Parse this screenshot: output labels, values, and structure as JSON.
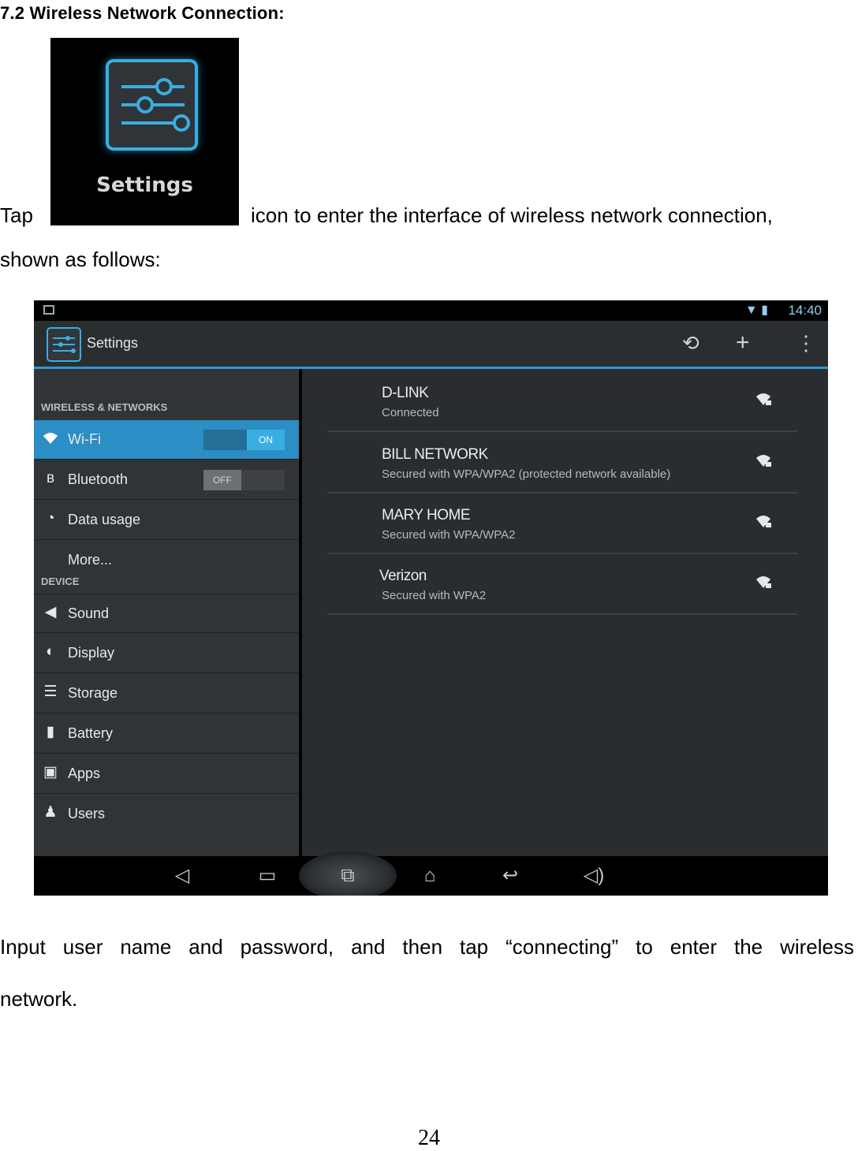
{
  "heading": "7.2 Wireless Network Connection:",
  "settings_badge_label": "Settings",
  "intro": {
    "before": "Tap",
    "after": "icon to enter the interface of wireless network connection,",
    "line2": "shown as follows:"
  },
  "screenshot": {
    "status_time": "14:40",
    "action_bar_title": "Settings",
    "sidebar": {
      "header_wireless": "WIRELESS & NETWORKS",
      "header_device": "DEVICE",
      "items": [
        {
          "label": "Wi-Fi",
          "icon": "wifi-icon",
          "toggle": "ON"
        },
        {
          "label": "Bluetooth",
          "icon": "bluetooth-icon",
          "toggle": "OFF"
        },
        {
          "label": "Data usage",
          "icon": "data-usage-icon"
        },
        {
          "label": "More..."
        },
        {
          "label": "Sound",
          "icon": "speaker-icon"
        },
        {
          "label": "Display",
          "icon": "display-icon"
        },
        {
          "label": "Storage",
          "icon": "storage-icon"
        },
        {
          "label": "Battery",
          "icon": "battery-icon"
        },
        {
          "label": "Apps",
          "icon": "apps-icon"
        },
        {
          "label": "Users",
          "icon": "users-icon"
        }
      ]
    },
    "networks": [
      {
        "name": "D-LINK",
        "status": "Connected"
      },
      {
        "name": "BILL NETWORK",
        "status": "Secured with WPA/WPA2 (protected network available)"
      },
      {
        "name": "MARY HOME",
        "status": "Secured with WPA/WPA2"
      },
      {
        "name": "Verizon",
        "status": "Secured with WPA2"
      }
    ]
  },
  "paragraph": {
    "line1": "Input user name and password, and then tap “connecting” to enter the wireless",
    "line2": "network."
  },
  "page_number": "24"
}
